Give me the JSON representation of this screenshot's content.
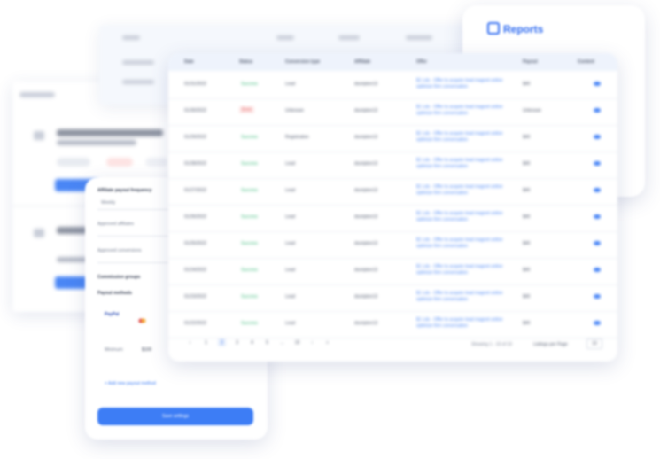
{
  "reports": {
    "title": "Reports"
  },
  "table": {
    "columns": [
      "Date",
      "Status",
      "Conversion type",
      "Affiliate",
      "Offer",
      "Payout",
      "Content"
    ],
    "rows": [
      {
        "date": "01/31/2022",
        "status": "Success",
        "ctype": "Lead",
        "aff": "dsoripton13",
        "offer": "$1 Lds - Offer to acquire lead magnet online optimize firm conversation",
        "payout": "$40",
        "err": false
      },
      {
        "date": "01/30/2022",
        "status": "Error",
        "ctype": "Unknown",
        "aff": "dsoripton13",
        "offer": "$1 Lds - Offer to acquire lead magnet online optimize firm conversation",
        "payout": "Unknown",
        "err": true
      },
      {
        "date": "01/29/2022",
        "status": "Success",
        "ctype": "Registration",
        "aff": "dsoripton13",
        "offer": "$1 Lds - Offer to acquire lead magnet online optimize firm conversation",
        "payout": "$40",
        "err": false
      },
      {
        "date": "01/28/2022",
        "status": "Success",
        "ctype": "Lead",
        "aff": "dsoripton13",
        "offer": "$1 Lds - Offer to acquire lead magnet online optimize firm conversation",
        "payout": "$40",
        "err": false
      },
      {
        "date": "01/27/2022",
        "status": "Success",
        "ctype": "Lead",
        "aff": "dsoripton13",
        "offer": "$1 Lds - Offer to acquire lead magnet online optimize firm conversation",
        "payout": "$40",
        "err": false
      },
      {
        "date": "01/26/2022",
        "status": "Success",
        "ctype": "Lead",
        "aff": "dsoripton13",
        "offer": "$1 Lds - Offer to acquire lead magnet online optimize firm conversation",
        "payout": "$40",
        "err": false
      },
      {
        "date": "01/25/2022",
        "status": "Success",
        "ctype": "Lead",
        "aff": "dsoripton13",
        "offer": "$1 Lds - Offer to acquire lead magnet online optimize firm conversation",
        "payout": "$40",
        "err": false
      },
      {
        "date": "01/24/2022",
        "status": "Success",
        "ctype": "Lead",
        "aff": "dsoripton13",
        "offer": "$1 Lds - Offer to acquire lead magnet online optimize firm conversation",
        "payout": "$40",
        "err": false
      },
      {
        "date": "01/23/2022",
        "status": "Success",
        "ctype": "Lead",
        "aff": "dsoripton13",
        "offer": "$1 Lds - Offer to acquire lead magnet online optimize firm conversation",
        "payout": "$40",
        "err": false
      },
      {
        "date": "01/22/2022",
        "status": "Success",
        "ctype": "Lead",
        "aff": "dsoripton13",
        "offer": "$1 Lds - Offer to acquire lead magnet online optimize firm conversation",
        "payout": "$40",
        "err": false
      }
    ]
  },
  "pagination": {
    "prev": "‹",
    "first": "1",
    "pages": [
      "2",
      "3",
      "4",
      "5",
      "...",
      "10",
      "›",
      "»"
    ],
    "active": "2",
    "showing": "Showing 1 - 10 of 10",
    "lpp_label": "Listings per Page",
    "lpp_value": "10"
  },
  "settings": {
    "payout_freq_label": "Affiliate payout frequency",
    "payout_freq_value": "Weekly",
    "approved_affiliates": "Approved affiliates",
    "approved_conversions": "Approved conversions",
    "commission_groups": "Commission groups",
    "payout_methods": "Payout methods",
    "paypal": "PayPal",
    "min_label": "Minimum:",
    "min_value": "$100",
    "add_method": "+ Add new payout method",
    "save": "Save settings"
  },
  "colors": {
    "accent": "#3d7df5",
    "success": "#3fbb7d",
    "error": "#e25555"
  }
}
